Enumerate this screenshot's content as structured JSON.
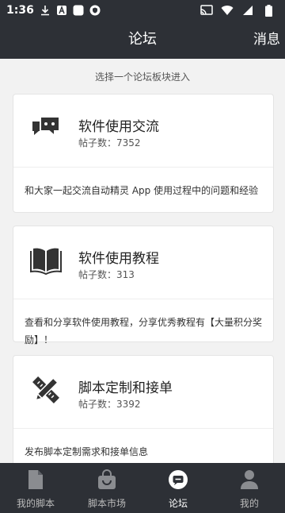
{
  "status_bar": {
    "time": "1:36"
  },
  "nav": {
    "title": "论坛",
    "message_label": "消息"
  },
  "hint": "选择一个论坛板块进入",
  "forums": [
    {
      "title": "软件使用交流",
      "count": "帖子数：7352",
      "description": "和大家一起交流自动精灵 App 使用过程中的问题和经验",
      "icon": "chat-bubbles-icon"
    },
    {
      "title": "软件使用教程",
      "count": "帖子数：313",
      "description": "查看和分享软件使用教程，分享优秀教程有【大量积分奖励】！",
      "icon": "open-book-icon"
    },
    {
      "title": "脚本定制和接单",
      "count": "帖子数：3392",
      "description": "发布脚本定制需求和接单信息",
      "icon": "pencil-ruler-icon"
    }
  ],
  "tabs": [
    {
      "label": "我的脚本",
      "icon": "document-icon",
      "active": false
    },
    {
      "label": "脚本市场",
      "icon": "shopping-bag-icon",
      "active": false
    },
    {
      "label": "论坛",
      "icon": "chat-icon",
      "active": true
    },
    {
      "label": "我的",
      "icon": "person-icon",
      "active": false
    }
  ],
  "colors": {
    "bar_bg": "#2d3036",
    "page_bg": "#f2f2f2",
    "card_bg": "#ffffff"
  }
}
